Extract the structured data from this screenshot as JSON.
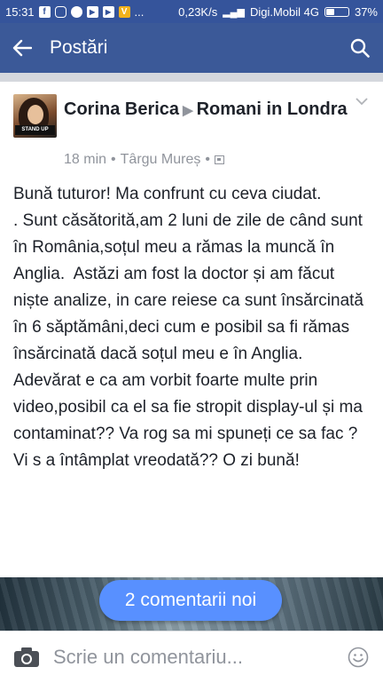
{
  "status_bar": {
    "time": "15:31",
    "notification_icons": [
      "facebook-icon",
      "instagram-icon",
      "messenger-icon",
      "youtube-icon",
      "play-icon",
      "vodafone-icon"
    ],
    "more": "...",
    "speed": "0,23K/s",
    "carrier": "Digi.Mobil 4G",
    "battery": "37%",
    "battery_level": 0.37
  },
  "app_bar": {
    "title": "Postări",
    "background": "#3b5998"
  },
  "post": {
    "author": "Corina Berica",
    "group": "Romani in Londra",
    "avatar_badge": "STAND UP",
    "time": "18 min",
    "location": "Târgu Mureș",
    "dot": "•",
    "text": "Bună tuturor! Ma confrunt cu ceva ciudat.\n. Sunt căsătorită,am 2 luni de zile de când sunt în România,soțul meu a rămas la muncă în Anglia.  Astăzi am fost la doctor și am făcut niște analize, in care reiese ca sunt însărcinată în 6 săptămâni,deci cum e posibil sa fi rămas însărcinată dacă soțul meu e în Anglia.  Adevărat e ca am vorbit foarte multe prin video,posibil ca el sa fie stropit display-ul și ma contaminat?? Va rog sa mi spuneți ce sa fac ? Vi s a întâmplat vreodată?? O zi bună!"
  },
  "new_comments": {
    "label": "2 comentarii noi",
    "color": "#5890ff"
  },
  "composer": {
    "placeholder": "Scrie un comentariu..."
  }
}
